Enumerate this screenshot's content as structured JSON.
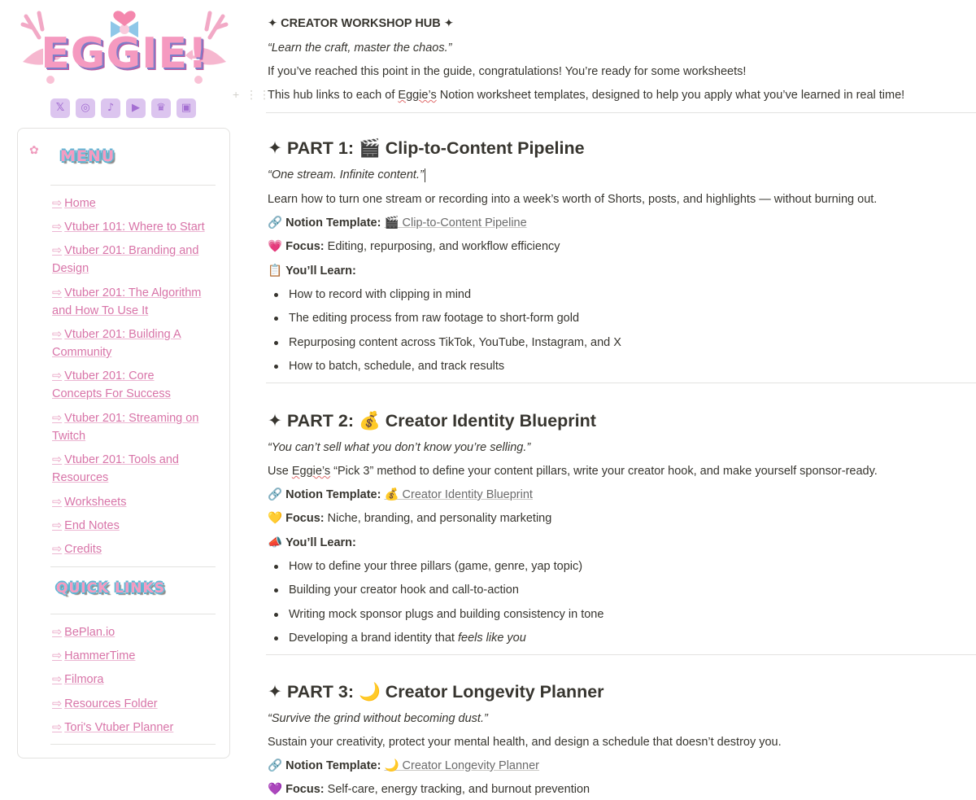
{
  "logo": {
    "text": "EGGIE!"
  },
  "socials": [
    {
      "icon": "x-icon",
      "glyph": "𝕏"
    },
    {
      "icon": "instagram-icon",
      "glyph": "◎"
    },
    {
      "icon": "tiktok-icon",
      "glyph": "♪"
    },
    {
      "icon": "youtube-icon",
      "glyph": "▶"
    },
    {
      "icon": "vgen-icon",
      "glyph": "♛"
    },
    {
      "icon": "twitch-icon",
      "glyph": "▣"
    }
  ],
  "sidebar": {
    "menu_title": "MENU",
    "arrow": "⇨",
    "menu_items": [
      {
        "l1": "Home",
        "l2": ""
      },
      {
        "l1": "Vtuber 101: Where to Start",
        "l2": ""
      },
      {
        "l1": "Vtuber 201: Branding and",
        "l2": "Design"
      },
      {
        "l1": "Vtuber 201: The Algorithm",
        "l2": "and How To Use It"
      },
      {
        "l1": "Vtuber 201: Building A",
        "l2": "Community"
      },
      {
        "l1": "Vtuber 201: Core",
        "l2": "Concepts For Success"
      },
      {
        "l1": "Vtuber 201: Streaming on",
        "l2": "Twitch"
      },
      {
        "l1": "Vtuber 201: Tools and",
        "l2": "Resources"
      },
      {
        "l1": "Worksheets",
        "l2": ""
      },
      {
        "l1": "End Notes",
        "l2": ""
      },
      {
        "l1": "Credits",
        "l2": ""
      }
    ],
    "quick_title": "QUICK LINKS",
    "quick_links": [
      "BePlan.io",
      "HammerTime",
      "Filmora",
      "Resources Folder",
      "Tori's Vtuber Planner"
    ]
  },
  "main": {
    "header": "✦ CREATOR WORKSHOP HUB ✦",
    "tagline": "“Learn the craft, master the chaos.”",
    "intro1": "If you’ve reached this point in the guide, congratulations! You’re ready for some worksheets!",
    "intro2_a": "This hub links to each of ",
    "intro2_b": "Eggie’s",
    "intro2_c": " Notion worksheet templates, designed to help you apply what you’ve learned in real time!",
    "labels": {
      "template": "Notion Template:",
      "focus": "Focus:",
      "learn": "You’ll Learn:"
    },
    "parts": [
      {
        "title": "✦ PART 1: 🎬 Clip-to-Content Pipeline",
        "quote": "“One stream. Infinite content.”",
        "desc": "Learn how to turn one stream or recording into a week’s worth of Shorts, posts, and highlights — without burning out.",
        "link_icon": "🔗",
        "template_link": "🎬 Clip-to-Content Pipeline",
        "focus_icon": "💗",
        "focus": " Editing, repurposing, and workflow efficiency",
        "learn_icon": "📋",
        "bullets": [
          "How to record with clipping in mind",
          "The editing process from raw footage to short-form gold",
          "Repurposing content across TikTok, YouTube, Instagram, and X",
          "How to batch, schedule, and track results"
        ]
      },
      {
        "title": "✦ PART 2: 💰 Creator Identity Blueprint",
        "quote": "“You can’t sell what you don’t know you’re selling.”",
        "desc_a": "Use ",
        "desc_b": "Eggie’s",
        "desc_c": " “Pick 3” method to define your content pillars, write your creator hook, and make yourself sponsor-ready.",
        "link_icon": "🔗",
        "template_link": "💰 Creator Identity Blueprint",
        "focus_icon": "💛",
        "focus": " Niche, branding, and personality marketing",
        "learn_icon": "📣",
        "bullets": [
          "How to define your three pillars (game, genre, yap topic)",
          "Building your creator hook and call-to-action",
          "Writing mock sponsor plugs and building consistency in tone"
        ],
        "bullet4_a": "Developing a brand identity that ",
        "bullet4_b": "feels like you"
      },
      {
        "title": "✦ PART 3: 🌙 Creator Longevity Planner",
        "quote": "“Survive the grind without becoming dust.”",
        "desc": "Sustain your creativity, protect your mental health, and design a schedule that doesn’t destroy you.",
        "link_icon": "🔗",
        "template_link": "🌙 Creator Longevity Planner",
        "focus_icon": "💜",
        "focus": " Self-care, energy tracking, and burnout prevention"
      }
    ]
  }
}
